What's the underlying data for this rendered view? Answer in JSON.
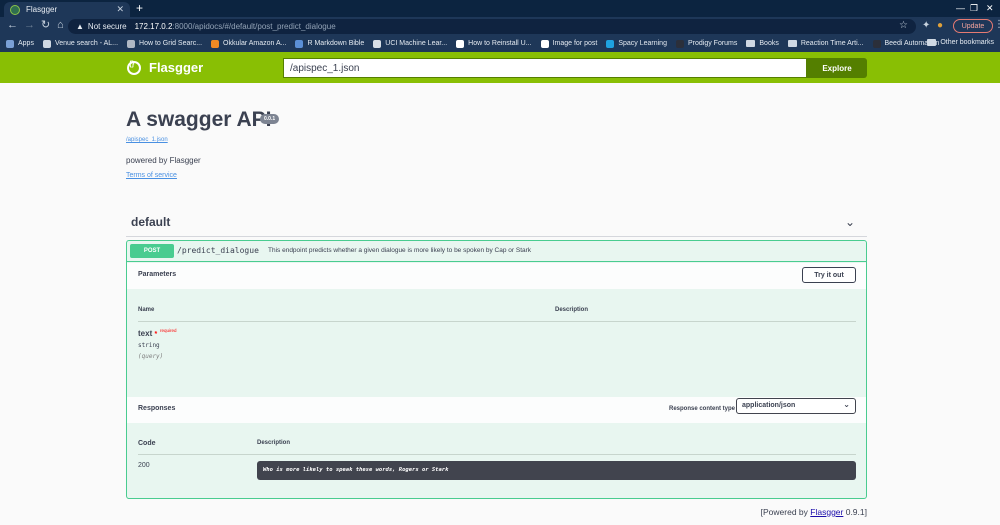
{
  "browser": {
    "tab_title": "Flasgger",
    "not_secure": "Not secure",
    "url_host": "172.17.0.2",
    "url_path": ":8000/apidocs/#/default/post_predict_dialogue",
    "update_label": "Update",
    "bookmarks": [
      {
        "label": "Apps",
        "color": "#7aa0d6"
      },
      {
        "label": "Venue search - AL...",
        "color": "#cfd8e3"
      },
      {
        "label": "How to Grid Searc...",
        "color": "#b0b8c4"
      },
      {
        "label": "Okkular Amazon A...",
        "color": "#f08a24"
      },
      {
        "label": "R Markdown Bible",
        "color": "#5b8fd6"
      },
      {
        "label": "UCI Machine Lear...",
        "color": "#d8dee6"
      },
      {
        "label": "How to Reinstall U...",
        "color": "#ffffff"
      },
      {
        "label": "Image for post",
        "color": "#ffffff"
      },
      {
        "label": "Spacy Learning",
        "color": "#1fa3e0"
      },
      {
        "label": "Prodigy Forums",
        "color": "#2b2f3a"
      },
      {
        "label": "Books",
        "color": "#cfd8e3"
      },
      {
        "label": "Reaction Time Arti...",
        "color": "#cfd8e3"
      },
      {
        "label": "Beedi Automation",
        "color": "#2b2f3a"
      }
    ],
    "other_bookmarks": "Other bookmarks"
  },
  "topbar": {
    "logo_text": "Flasgger",
    "spec_url": "/apispec_1.json",
    "explore_label": "Explore",
    "brand_color": "#89bf04"
  },
  "info": {
    "title": "A swagger API",
    "version": "0.0.1",
    "spec_link": "/apispec_1.json",
    "powered_by": "powered by Flasgger",
    "terms": "Terms of service"
  },
  "section": {
    "title": "default"
  },
  "operation": {
    "method": "POST",
    "path": "/predict_dialogue",
    "summary": "This endpoint predicts whether a given dialogue is more likely to be spoken by Cap or Stark",
    "parameters_label": "Parameters",
    "try_label": "Try it out",
    "col_name": "Name",
    "col_description": "Description",
    "param": {
      "name": "text",
      "required_star": "*",
      "required_label": "required",
      "type": "string",
      "in": "(query)"
    },
    "responses_label": "Responses",
    "content_type_label": "Response content type",
    "content_type": "application/json",
    "col_code": "Code",
    "resp_col_description": "Description",
    "response": {
      "code": "200",
      "description": "Who is more likely to speak these words, Rogers or Stark"
    }
  },
  "footer": {
    "prefix": "[Powered by ",
    "link": "Flasgger",
    "suffix": " 0.9.1]"
  }
}
